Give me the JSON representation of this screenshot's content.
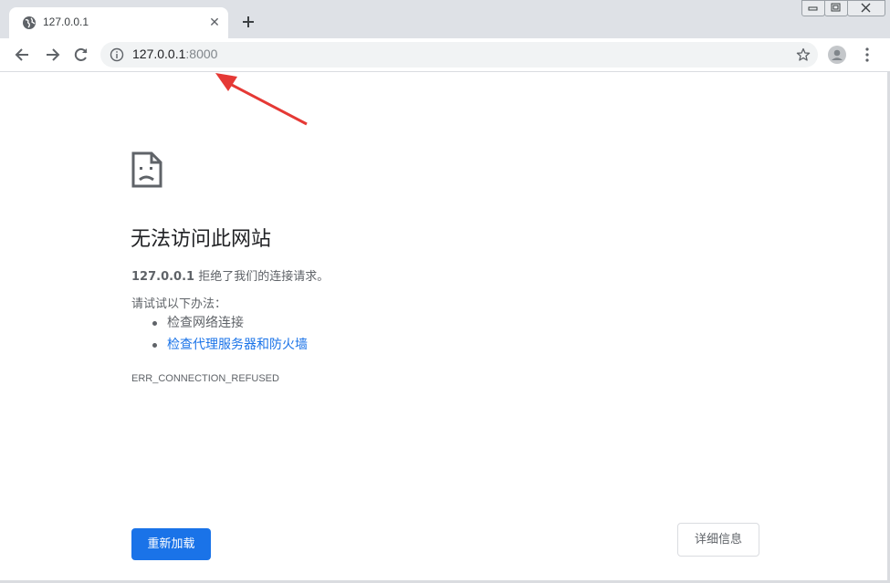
{
  "tab": {
    "title": "127.0.0.1",
    "close": "✕"
  },
  "toolbar": {
    "url_host": "127.0.0.1",
    "url_port": ":8000"
  },
  "error": {
    "title": "无法访问此网站",
    "host": "127.0.0.1",
    "message_suffix": " 拒绝了我们的连接请求。",
    "try_label": "请试试以下办法：",
    "suggestions": [
      {
        "label": "检查网络连接",
        "is_link": false
      },
      {
        "label": "检查代理服务器和防火墙",
        "is_link": true
      }
    ],
    "code": "ERR_CONNECTION_REFUSED"
  },
  "buttons": {
    "reload": "重新加载",
    "details": "详细信息"
  },
  "colors": {
    "accent": "#1a73e8",
    "annotation_arrow": "#e53935",
    "tabstrip": "#dee1e6"
  },
  "icons": {
    "tab": "globe-icon",
    "back": "back-arrow-icon",
    "forward": "forward-arrow-icon",
    "reload": "reload-icon",
    "info": "info-icon",
    "bookmark": "star-icon",
    "profile": "profile-avatar-icon",
    "menu": "kebab-menu-icon",
    "error": "sad-document-icon"
  }
}
